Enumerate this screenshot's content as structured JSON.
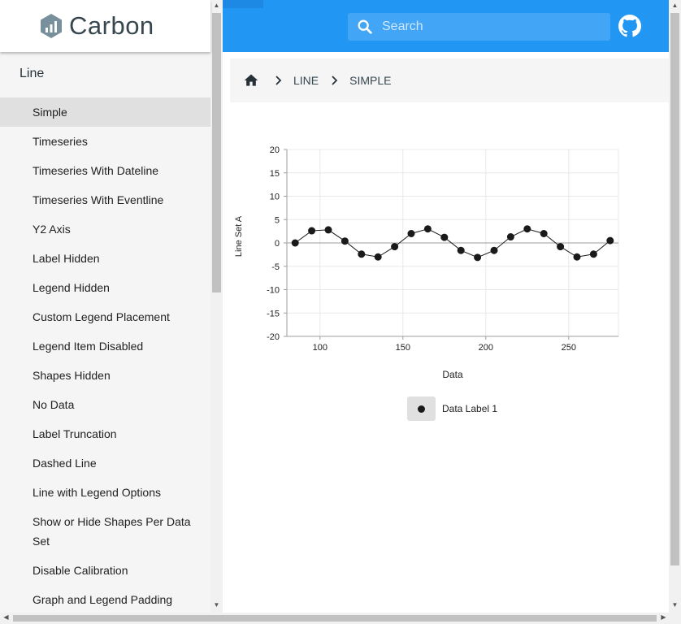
{
  "brand": {
    "title": "Carbon"
  },
  "sidebar": {
    "section": "Line",
    "items": [
      {
        "label": "Simple",
        "active": true
      },
      {
        "label": "Timeseries"
      },
      {
        "label": "Timeseries With Dateline"
      },
      {
        "label": "Timeseries With Eventline"
      },
      {
        "label": "Y2 Axis"
      },
      {
        "label": "Label Hidden"
      },
      {
        "label": "Legend Hidden"
      },
      {
        "label": "Custom Legend Placement"
      },
      {
        "label": "Legend Item Disabled"
      },
      {
        "label": "Shapes Hidden"
      },
      {
        "label": "No Data"
      },
      {
        "label": "Label Truncation"
      },
      {
        "label": "Dashed Line"
      },
      {
        "label": "Line with Legend Options"
      },
      {
        "label": "Show or Hide Shapes Per Data Set"
      },
      {
        "label": "Disable Calibration"
      },
      {
        "label": "Graph and Legend Padding"
      }
    ]
  },
  "header": {
    "search_placeholder": "Search",
    "accent": "#2196f3"
  },
  "breadcrumb": {
    "items": [
      "LINE",
      "SIMPLE"
    ]
  },
  "chart_data": {
    "type": "line",
    "xlabel": "Data",
    "ylabel": "Line Set A",
    "xlim": [
      80,
      280
    ],
    "ylim": [
      -20,
      20
    ],
    "xticks": [
      100,
      150,
      200,
      250
    ],
    "yticks": [
      20,
      15,
      10,
      5,
      0,
      -5,
      -10,
      -15,
      -20
    ],
    "grid": true,
    "legend_position": "bottom",
    "series": [
      {
        "name": "Data Label 1",
        "color": "#1a1a1a",
        "x": [
          85,
          95,
          105,
          115,
          125,
          135,
          145,
          155,
          165,
          175,
          185,
          195,
          205,
          215,
          225,
          235,
          245,
          255,
          265,
          275
        ],
        "y": [
          0,
          2.6,
          2.8,
          0.4,
          -2.4,
          -3.0,
          -0.8,
          2.0,
          3.0,
          1.2,
          -1.6,
          -3.1,
          -1.6,
          1.3,
          3.0,
          2.0,
          -0.8,
          -3.0,
          -2.4,
          0.5
        ]
      }
    ]
  }
}
